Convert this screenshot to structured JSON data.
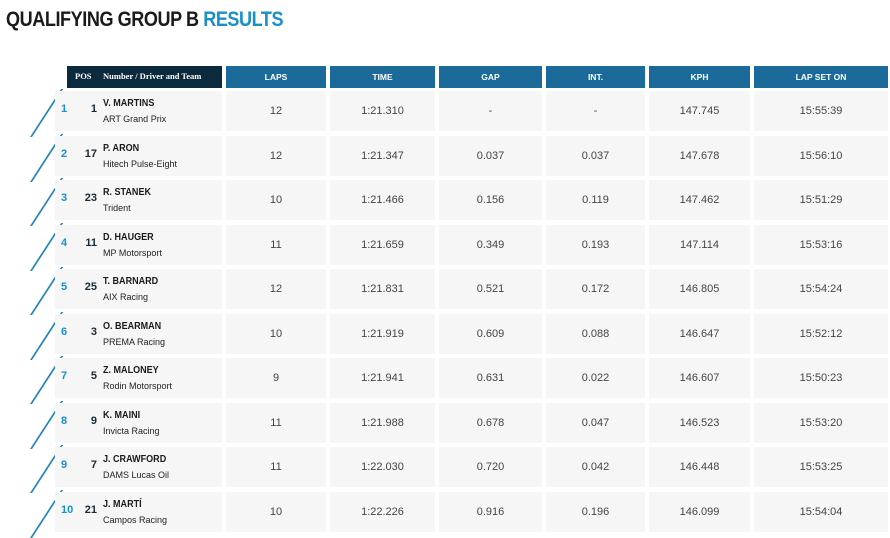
{
  "page": {
    "title_part1": "QUALIFYING GROUP B",
    "title_part2": "RESULTS"
  },
  "header": {
    "pos": "POS",
    "number_driver_team": "Number / Driver and Team",
    "laps": "LAPS",
    "time": "TIME",
    "gap": "GAP",
    "int": "INT.",
    "kph": "KPH",
    "lap_set_on": "LAP SET ON"
  },
  "colors": {
    "accent_blue": "#1a8fc9",
    "header_dark": "#0c2a3e",
    "header_blue": "#1b6a99",
    "row_bg": "#f6f6f6"
  },
  "rows": [
    {
      "pos": "1",
      "number": "1",
      "driver": "V. MARTINS",
      "team": "ART Grand Prix",
      "laps": "12",
      "time": "1:21.310",
      "gap": "-",
      "int": "-",
      "kph": "147.745",
      "lap_set_on": "15:55:39"
    },
    {
      "pos": "2",
      "number": "17",
      "driver": "P. ARON",
      "team": "Hitech Pulse-Eight",
      "laps": "12",
      "time": "1:21.347",
      "gap": "0.037",
      "int": "0.037",
      "kph": "147.678",
      "lap_set_on": "15:56:10"
    },
    {
      "pos": "3",
      "number": "23",
      "driver": "R. STANEK",
      "team": "Trident",
      "laps": "10",
      "time": "1:21.466",
      "gap": "0.156",
      "int": "0.119",
      "kph": "147.462",
      "lap_set_on": "15:51:29"
    },
    {
      "pos": "4",
      "number": "11",
      "driver": "D. HAUGER",
      "team": "MP Motorsport",
      "laps": "11",
      "time": "1:21.659",
      "gap": "0.349",
      "int": "0.193",
      "kph": "147.114",
      "lap_set_on": "15:53:16"
    },
    {
      "pos": "5",
      "number": "25",
      "driver": "T. BARNARD",
      "team": "AIX Racing",
      "laps": "12",
      "time": "1:21.831",
      "gap": "0.521",
      "int": "0.172",
      "kph": "146.805",
      "lap_set_on": "15:54:24"
    },
    {
      "pos": "6",
      "number": "3",
      "driver": "O. BEARMAN",
      "team": "PREMA Racing",
      "laps": "10",
      "time": "1:21.919",
      "gap": "0.609",
      "int": "0.088",
      "kph": "146.647",
      "lap_set_on": "15:52:12"
    },
    {
      "pos": "7",
      "number": "5",
      "driver": "Z. MALONEY",
      "team": "Rodin Motorsport",
      "laps": "9",
      "time": "1:21.941",
      "gap": "0.631",
      "int": "0.022",
      "kph": "146.607",
      "lap_set_on": "15:50:23"
    },
    {
      "pos": "8",
      "number": "9",
      "driver": "K. MAINI",
      "team": "Invicta Racing",
      "laps": "11",
      "time": "1:21.988",
      "gap": "0.678",
      "int": "0.047",
      "kph": "146.523",
      "lap_set_on": "15:53:20"
    },
    {
      "pos": "9",
      "number": "7",
      "driver": "J. CRAWFORD",
      "team": "DAMS Lucas Oil",
      "laps": "11",
      "time": "1:22.030",
      "gap": "0.720",
      "int": "0.042",
      "kph": "146.448",
      "lap_set_on": "15:53:25"
    },
    {
      "pos": "10",
      "number": "21",
      "driver": "J. MARTÍ",
      "team": "Campos Racing",
      "laps": "10",
      "time": "1:22.226",
      "gap": "0.916",
      "int": "0.196",
      "kph": "146.099",
      "lap_set_on": "15:54:04"
    }
  ]
}
